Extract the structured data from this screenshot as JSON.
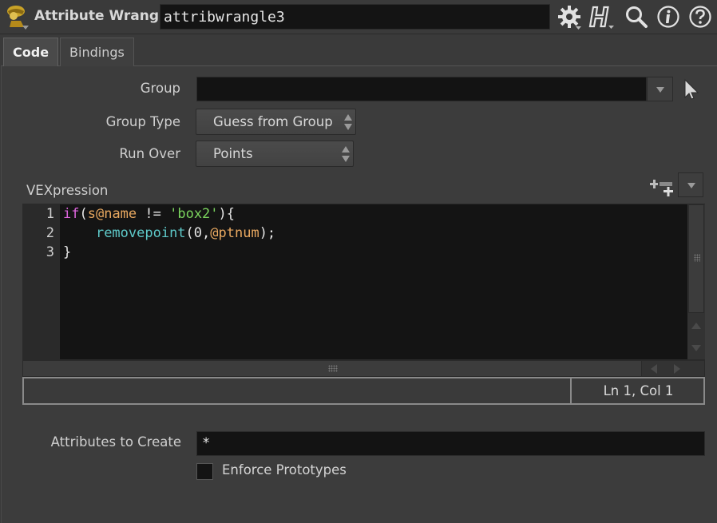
{
  "header": {
    "node_type": "Attribute Wrangle",
    "node_name": "attribwrangle3",
    "icons": [
      "gear-icon",
      "houdini-help-icon",
      "search-icon",
      "info-icon",
      "help-icon"
    ]
  },
  "tabs": [
    {
      "label": "Code",
      "active": true
    },
    {
      "label": "Bindings",
      "active": false
    }
  ],
  "params": {
    "group_label": "Group",
    "group_value": "",
    "group_type_label": "Group Type",
    "group_type_value": "Guess from Group",
    "run_over_label": "Run Over",
    "run_over_value": "Points",
    "vex_label": "VEXpression",
    "attrs_label": "Attributes to Create",
    "attrs_value": "*",
    "enforce_label": "Enforce Prototypes",
    "enforce_checked": false
  },
  "editor": {
    "line_numbers": [
      "1",
      "2",
      "3"
    ],
    "code_lines": [
      "if(s@name != 'box2'){",
      "    removepoint(0,@ptnum);",
      "}"
    ],
    "tokens": {
      "l1_kw": "if",
      "l1_p1": "(",
      "l1_var": "s@name",
      "l1_op": " != ",
      "l1_str": "'box2'",
      "l1_p2": "){",
      "l2_indent": "    ",
      "l2_fn": "removepoint",
      "l2_p1": "(0,",
      "l2_var": "@ptnum",
      "l2_p2": ");",
      "l3": "}"
    },
    "status": "Ln 1, Col 1"
  },
  "colors": {
    "keyword": "#e066e0",
    "variable": "#e8a860",
    "string": "#7bd55e",
    "function": "#5ec9c9",
    "field_bg": "#131313",
    "panel_bg": "#3c3c3c"
  }
}
